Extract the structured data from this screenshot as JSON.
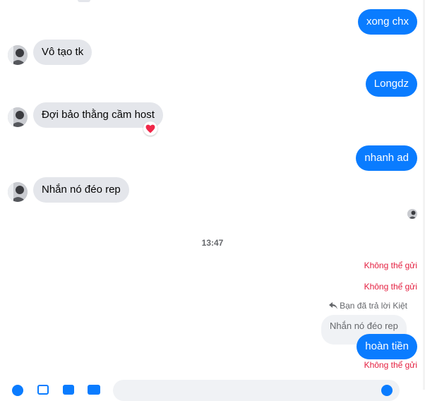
{
  "messages": [
    {
      "id": "m1",
      "dir": "out",
      "text": "xong chx"
    },
    {
      "id": "m2",
      "dir": "in",
      "text": "Vô tạo tk"
    },
    {
      "id": "m3",
      "dir": "out",
      "text": "Longdz"
    },
    {
      "id": "m4",
      "dir": "in",
      "text": "Đợi bảo thằng cầm host",
      "reaction": "heart"
    },
    {
      "id": "m5",
      "dir": "out",
      "text": "nhanh ad"
    },
    {
      "id": "m6",
      "dir": "in",
      "text": "Nhắn nó đéo rep"
    }
  ],
  "timestamp": "13:47",
  "failed_label": "Không thể gửi",
  "reply_note": "Bạn đã trả lời Kiệt",
  "quoted_message": "Nhắn nó đéo rep",
  "reply_message": "hoàn tiền",
  "colors": {
    "outgoing_bubble": "#0a7cff",
    "incoming_bubble": "#e4e6eb",
    "error_text": "#e41e3f",
    "muted_text": "#65676b"
  },
  "icons": {
    "reaction": "heart-icon",
    "reply": "reply-arrow-icon",
    "composer_actions": [
      "more-actions-icon",
      "image-icon",
      "sticker-icon",
      "gif-icon"
    ],
    "composer_end": "emoji-icon"
  }
}
